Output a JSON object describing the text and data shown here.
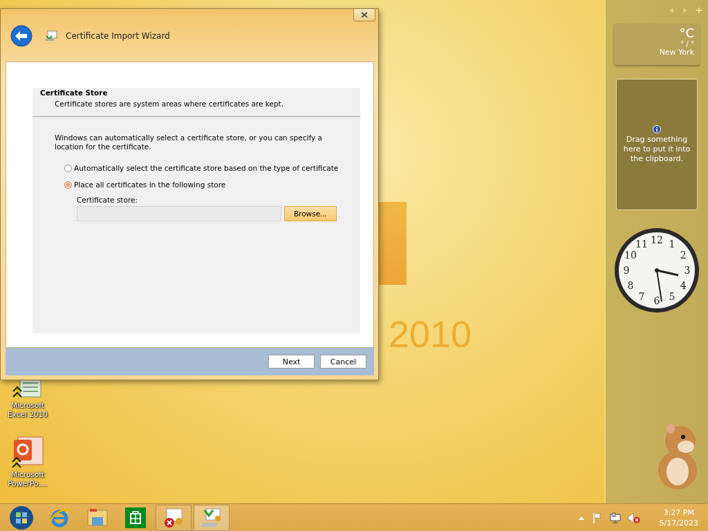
{
  "window": {
    "title": "Certificate Import Wizard",
    "header": {
      "title": "Certificate Store",
      "description": "Certificate stores are system areas where certificates are kept."
    },
    "intro": "Windows can automatically select a certificate store, or you can specify a location for the certificate.",
    "options": [
      {
        "label": "Automatically select the certificate store based on the type of certificate",
        "selected": false
      },
      {
        "label": "Place all certificates in the following store",
        "selected": true
      }
    ],
    "store_field": {
      "label": "Certificate store:",
      "disabled": true
    },
    "browse_button": "Browse...",
    "buttons": [
      "Next",
      "Cancel"
    ]
  },
  "wallpaper_text": "2010",
  "desktop_icons": [
    {
      "label": "Microsoft Excel 2010",
      "kind": "excel"
    },
    {
      "label": "Microsoft PowerPo....",
      "kind": "powerpoint"
    }
  ],
  "gadgets": {
    "weather": {
      "temperature": "°C",
      "range": "° / °",
      "city": "New York"
    },
    "clipboard": {
      "message": "Drag something here to put it into the clipboard."
    },
    "clock": {
      "numerals": [
        "12",
        "11",
        "1",
        "10",
        "2",
        "9",
        "3",
        "8",
        "4",
        "7",
        "5",
        "6"
      ]
    }
  },
  "taskbar": {
    "items": [
      {
        "kind": "start",
        "open": false,
        "selected": false
      },
      {
        "kind": "browser",
        "open": false,
        "selected": false
      },
      {
        "kind": "folder",
        "open": false,
        "selected": false
      },
      {
        "kind": "store",
        "open": false,
        "selected": false
      },
      {
        "kind": "cert-error",
        "open": true,
        "selected": false
      },
      {
        "kind": "cert-import",
        "open": true,
        "selected": true
      }
    ],
    "volume_muted": true,
    "time": "3:27 PM",
    "date": "5/17/2023"
  }
}
